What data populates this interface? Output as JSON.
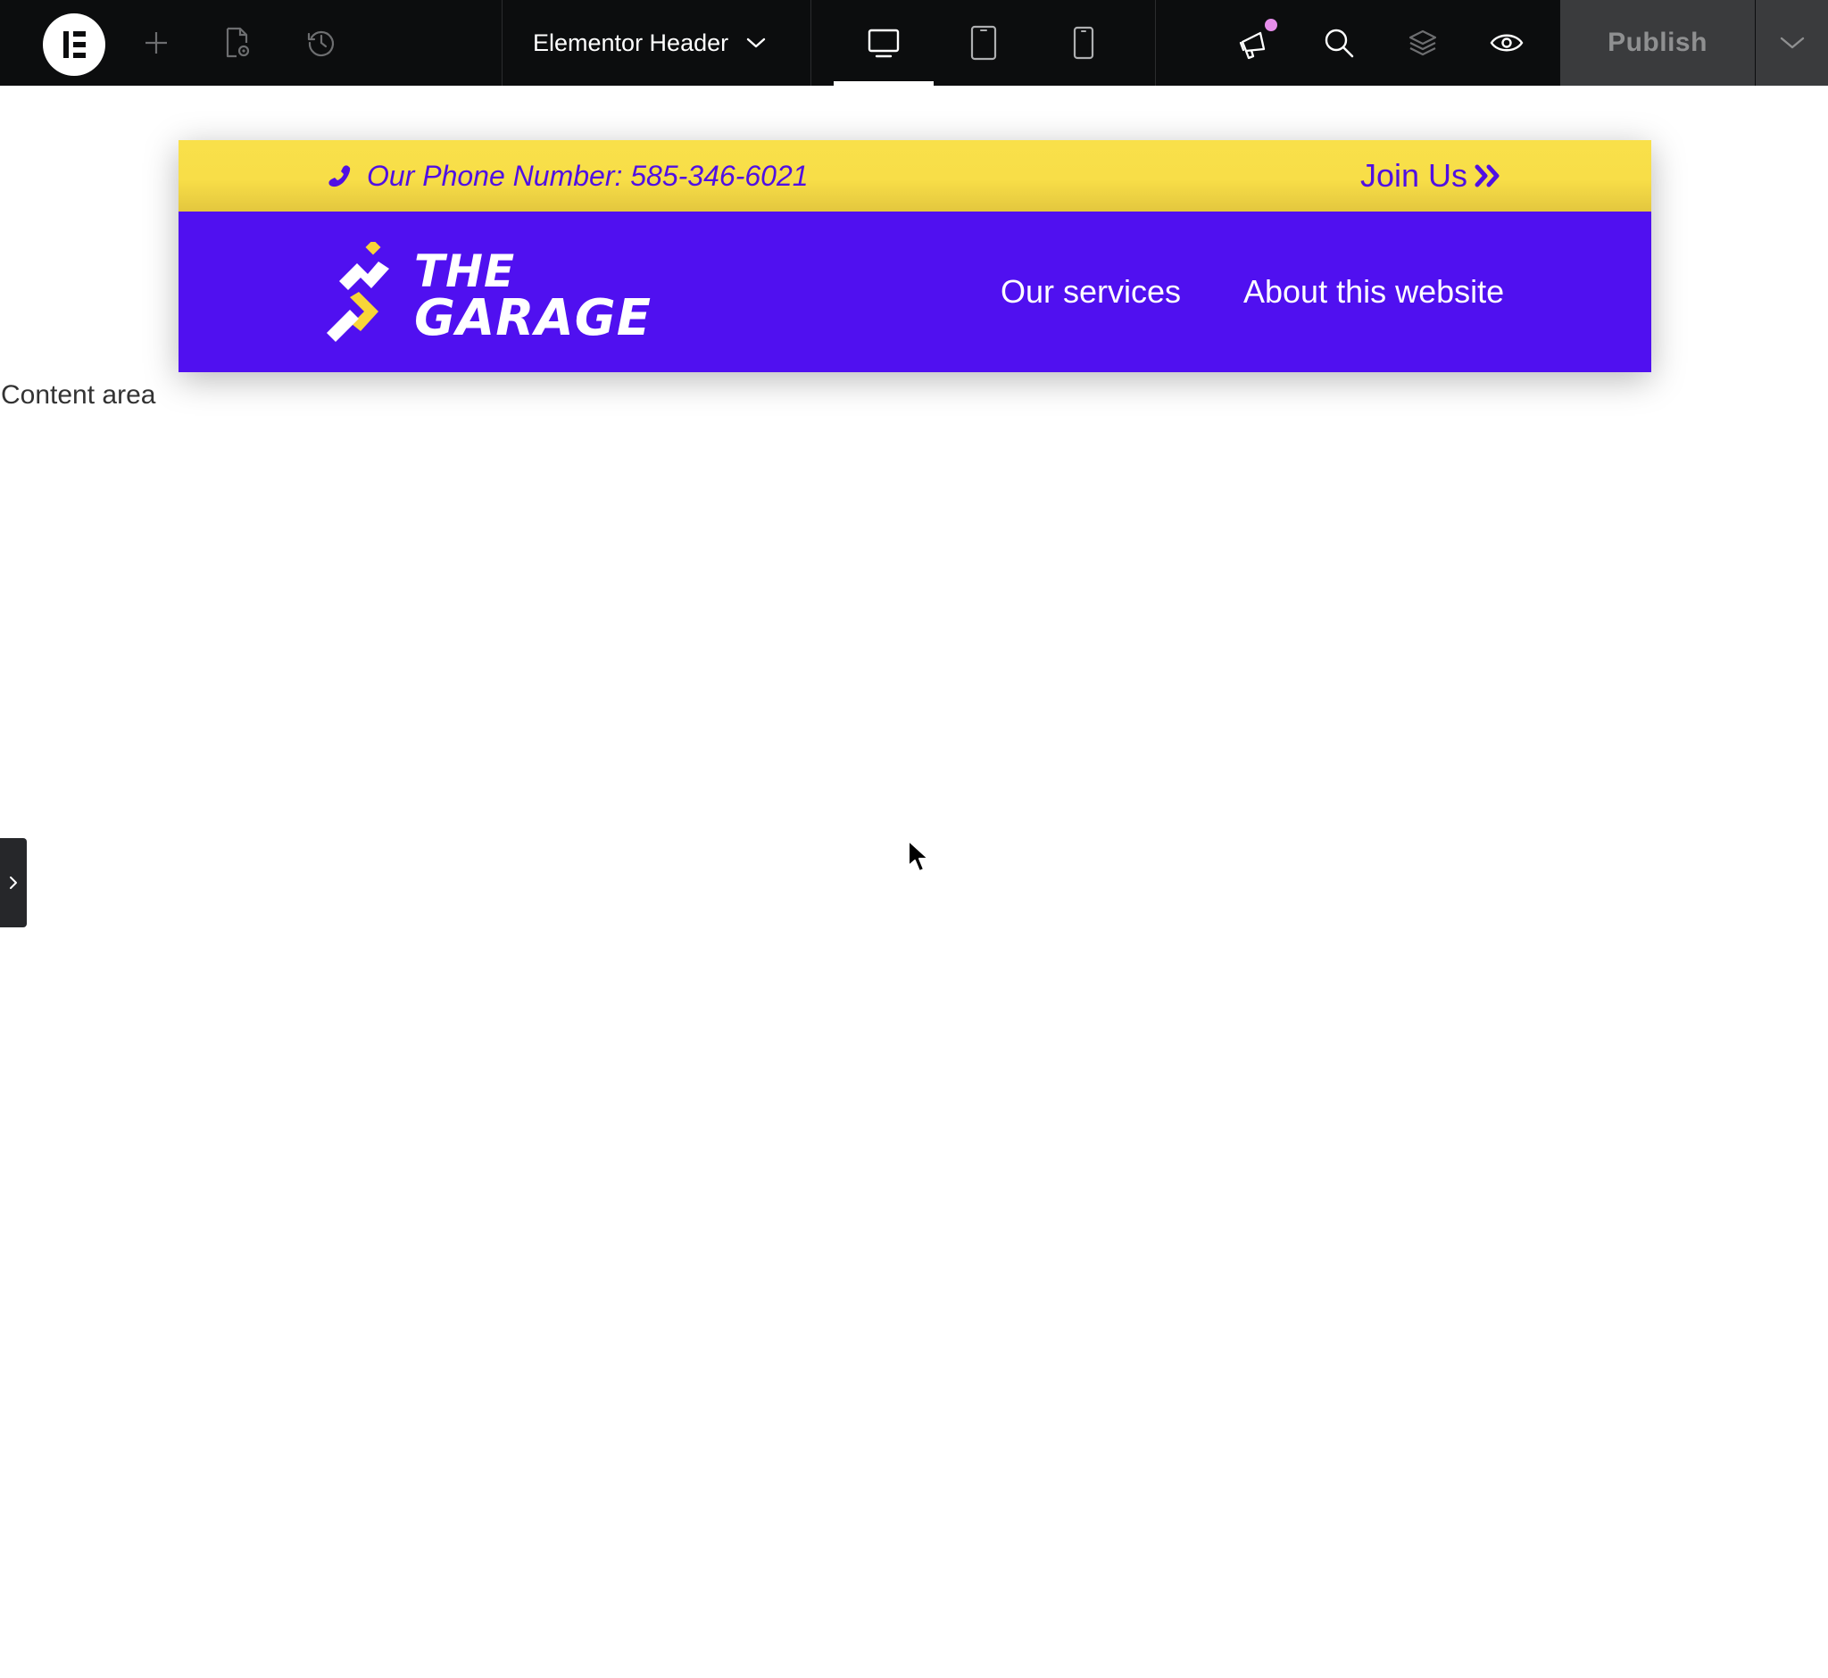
{
  "toolbar": {
    "document_title": "Elementor Header",
    "publish_label": "Publish"
  },
  "header_strip": {
    "phone_text": "Our Phone Number: 585-346-6021",
    "join_label": "Join Us"
  },
  "header_main": {
    "brand_line1": "THE",
    "brand_line2": "GARAGE",
    "nav": [
      "Our services",
      "About this website"
    ]
  },
  "canvas": {
    "content_label": "Content area"
  },
  "colors": {
    "toolbar_bg": "#0c0d0e",
    "strip_yellow": "#f9e04a",
    "brand_purple": "#5010f0",
    "text_purple": "#5010e3",
    "logo_yellow": "#f8d538",
    "notification_dot": "#e68dea"
  }
}
